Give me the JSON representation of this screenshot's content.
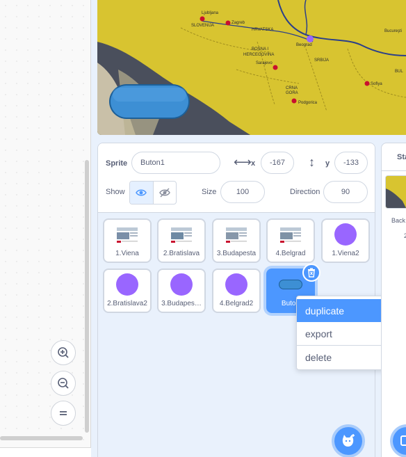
{
  "sprite_info": {
    "sprite_label": "Sprite",
    "sprite_name": "Buton1",
    "x_label": "x",
    "x_value": "-167",
    "y_label": "y",
    "y_value": "-133",
    "show_label": "Show",
    "size_label": "Size",
    "size_value": "100",
    "direction_label": "Direction",
    "direction_value": "90"
  },
  "sprites": [
    {
      "name": "1.Viena",
      "thumb": "map-thumb"
    },
    {
      "name": "2.Bratislava",
      "thumb": "map-thumb"
    },
    {
      "name": "3.Budapesta",
      "thumb": "map-thumb"
    },
    {
      "name": "4.Belgrad",
      "thumb": "map-thumb"
    },
    {
      "name": "1.Viena2",
      "thumb": "purple-circle"
    },
    {
      "name": "2.Bratislava2",
      "thumb": "purple-circle"
    },
    {
      "name": "3.Budapes…",
      "thumb": "purple-circle"
    },
    {
      "name": "4.Belgrad2",
      "thumb": "purple-circle"
    },
    {
      "name": "Buton",
      "thumb": "blue-button",
      "selected": true
    }
  ],
  "context_menu": {
    "duplicate": "duplicate",
    "export": "export",
    "delete": "delete"
  },
  "stage_pane": {
    "title": "Sta",
    "backdrops_label": "Back",
    "backdrops_count": "2"
  },
  "map_labels": {
    "ljubljana": "Ljubljana",
    "slovenija": "SLOVENIJA",
    "zagreb": "Zagreb",
    "hrvatska": "HRVATSKA",
    "bosna": "BOSNA I",
    "hercegovina": "HERCEGOVINA",
    "sarajevo": "Sarajevo",
    "beograd": "Beograd",
    "srbija": "SRBIJA",
    "crna": "CRNA",
    "gora": "GORA",
    "podgorica": "Podgorica",
    "bucuresti": "Bucureşti",
    "sofiya": "Sofiya",
    "bul": "BUL"
  },
  "colors": {
    "accent": "#4c97ff",
    "sprite_purple": "#9966ff",
    "land": "#d8c430",
    "sea": "#4a4f5c",
    "city": "#c8102e"
  }
}
